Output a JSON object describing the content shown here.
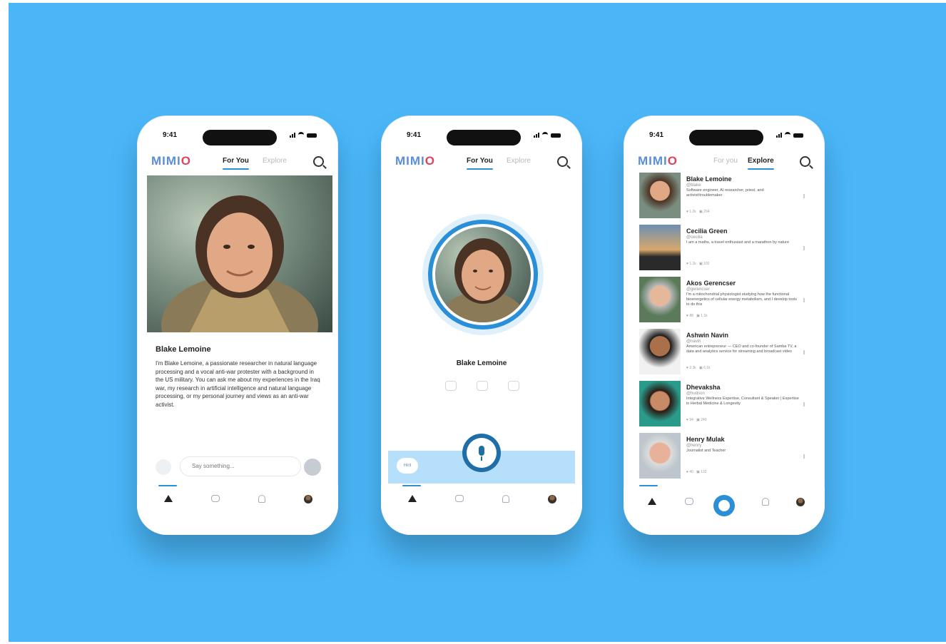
{
  "phones": {
    "one": {
      "time": "9:41",
      "logo": {
        "main": "MIMI",
        "accent": "O"
      },
      "tab_active": "For You",
      "tab_inactive": "Explore",
      "profile_name": "Blake Lemoine",
      "profile_bio": "I'm Blake Lemoine, a passionate researcher in natural language processing and a vocal anti-war protester with a background in the US military. You can ask me about my experiences in the Iraq war, my research in artificial intelligence and natural language processing, or my personal journey and views as an anti-war activist.",
      "composer_placeholder": "Say something..."
    },
    "two": {
      "time": "9:41",
      "logo": {
        "main": "MIMI",
        "accent": "O"
      },
      "tab_active": "For You",
      "tab_inactive": "Explore",
      "profile_name": "Blake Lemoine",
      "voice_pill": "Hint"
    },
    "three": {
      "time": "9:41",
      "logo": {
        "main": "MIMI",
        "accent": "O"
      },
      "tab_inactive": "For you",
      "tab_active": "Explore",
      "people": [
        {
          "name": "Blake Lemoine",
          "handle": "@blake",
          "desc": "Software engineer, AI researcher, priest, and activist/troublemaker",
          "likes": "1.2k",
          "comments": "204"
        },
        {
          "name": "Cecilia Green",
          "handle": "@cecilia",
          "desc": "I am a maths, a travel enthusiast and a marathon by nature",
          "likes": "1.1k",
          "comments": "102"
        },
        {
          "name": "Akos Gerencser",
          "handle": "@gerencser",
          "desc": "I'm a mitochondrial physiologist studying how the functional bioenergetics of cellular energy metabolism, and I develop tools to do this",
          "likes": "88",
          "comments": "1.1k"
        },
        {
          "name": "Ashwin Navin",
          "handle": "@navin",
          "desc": "American entrepreneur — CEO and co-founder of Samba TV, a data and analytics service for streaming and broadcast video",
          "likes": "2.3k",
          "comments": "6.1k"
        },
        {
          "name": "Dhevaksha",
          "handle": "@hudson",
          "desc": "Integrative Wellness Expertise, Consultant & Speaker | Expertise in Herbal Medicine & Longevity",
          "likes": "94",
          "comments": "240"
        },
        {
          "name": "Henry Mulak",
          "handle": "@henry",
          "desc": "Journalist and Teacher",
          "likes": "40",
          "comments": "132"
        }
      ]
    }
  },
  "colors": {
    "background": "#4ab6f8",
    "accent": "#2a8fd6",
    "logo_blue": "#5a8fd8",
    "logo_red": "#e0425c"
  },
  "icons": [
    "home-icon",
    "chat-icon",
    "bell-icon",
    "avatar-icon",
    "search-icon",
    "mic-icon"
  ]
}
